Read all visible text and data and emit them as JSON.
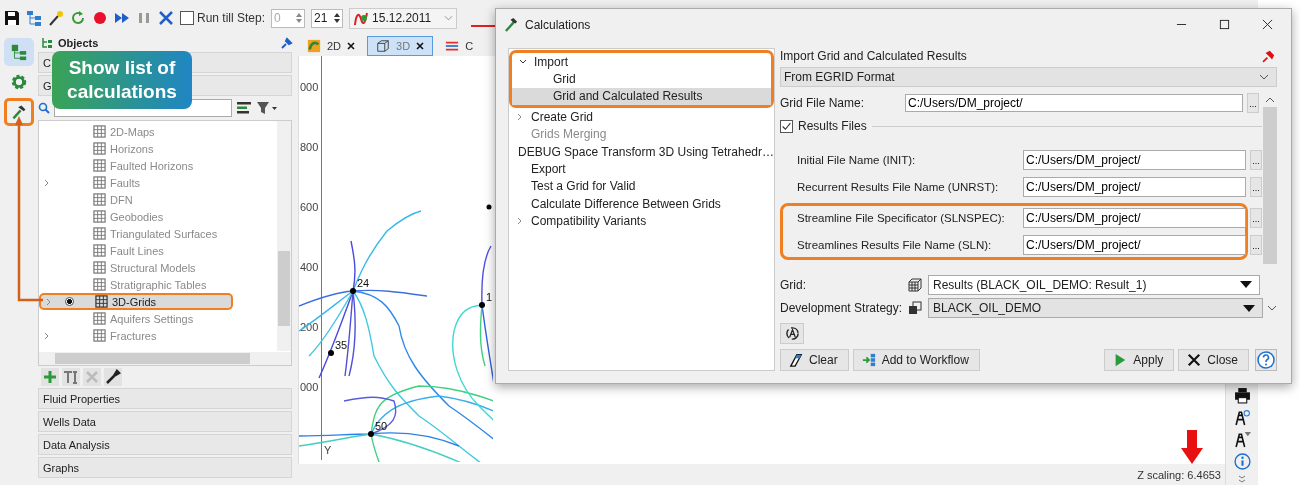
{
  "toolbar": {
    "run_till_step": {
      "label": "Run till Step:",
      "checked": false,
      "value": "0"
    },
    "step_value": "21",
    "date": "15.12.2011"
  },
  "rail": [
    {
      "kind": "tree",
      "selected": true,
      "highlighted": false
    },
    {
      "kind": "gear",
      "selected": false,
      "highlighted": false
    },
    {
      "kind": "hammer",
      "selected": false,
      "highlighted": true
    }
  ],
  "objects_panel": {
    "title": "Objects",
    "top_sections": [
      "C",
      "G"
    ],
    "tree": [
      {
        "label": "2D-Maps",
        "disabled": true,
        "selected": false,
        "highlighted": false
      },
      {
        "label": "Horizons",
        "disabled": true,
        "selected": false,
        "highlighted": false
      },
      {
        "label": "Faulted Horizons",
        "disabled": true,
        "selected": false,
        "highlighted": false
      },
      {
        "label": "Faults",
        "disabled": true,
        "selected": false,
        "highlighted": false,
        "expanded": false
      },
      {
        "label": "DFN",
        "disabled": true,
        "selected": false,
        "highlighted": false
      },
      {
        "label": "Geobodies",
        "disabled": true,
        "selected": false,
        "highlighted": false
      },
      {
        "label": "Triangulated Surfaces",
        "disabled": true,
        "selected": false,
        "highlighted": false
      },
      {
        "label": "Fault Lines",
        "disabled": true,
        "selected": false,
        "highlighted": false
      },
      {
        "label": "Structural Models",
        "disabled": true,
        "selected": false,
        "highlighted": false
      },
      {
        "label": "Stratigraphic Tables",
        "disabled": true,
        "selected": false,
        "highlighted": false
      },
      {
        "label": "3D-Grids",
        "disabled": false,
        "selected": true,
        "highlighted": true,
        "expanded": false,
        "active": true
      },
      {
        "label": "Aquifers Settings",
        "disabled": true,
        "selected": false,
        "highlighted": false
      },
      {
        "label": "Fractures",
        "disabled": true,
        "selected": false,
        "highlighted": false,
        "expanded": false
      }
    ],
    "sections": [
      "Fluid Properties",
      "Wells Data",
      "Data Analysis",
      "Graphs"
    ]
  },
  "callout": "Show list of calculations",
  "viewport": {
    "tabs": [
      {
        "label": "2D",
        "selected": false,
        "closable": true
      },
      {
        "label": "3D",
        "selected": true,
        "closable": true
      },
      {
        "label": "C",
        "selected": false,
        "closable": false
      }
    ],
    "axis_labels": [
      "000",
      "800",
      "600",
      "400",
      "200",
      "000"
    ],
    "axis_title": "Y",
    "wells": [
      "24",
      "35",
      "50",
      "1"
    ],
    "status": "Z scaling: 6.4653"
  },
  "dialog": {
    "title": "Calculations",
    "tree": [
      {
        "label": "Import",
        "selected": false,
        "highlighted": true,
        "expanded": true,
        "children": [
          {
            "label": "Grid",
            "selected": false
          },
          {
            "label": "Grid and Calculated Results",
            "selected": true
          }
        ]
      },
      {
        "label": "Create Grid",
        "selected": false,
        "highlighted": false,
        "expanded": false
      },
      {
        "label": "Grids Merging",
        "selected": false,
        "highlighted": false,
        "disabled": true
      },
      {
        "label": "DEBUG Space Transform 3D Using Tetrahedr…",
        "selected": false,
        "highlighted": false
      },
      {
        "label": "Export",
        "selected": false,
        "highlighted": false
      },
      {
        "label": "Test a Grid for Valid",
        "selected": false,
        "highlighted": false
      },
      {
        "label": "Calculate Difference Between Grids",
        "selected": false,
        "highlighted": false
      },
      {
        "label": "Compatibility Variants",
        "selected": false,
        "highlighted": false,
        "expanded": false
      }
    ],
    "heading": "Import Grid and Calculated Results",
    "format": "From EGRID Format",
    "grid_file": {
      "label": "Grid File Name:",
      "value": "C:/Users/DM_project/",
      "browse": "..."
    },
    "results_files": {
      "label": "Results Files",
      "checked": true
    },
    "files": [
      {
        "label": "Initial File Name (INIT):",
        "value": "C:/Users/DM_project/",
        "browse": "...",
        "highlighted": false
      },
      {
        "label": "Recurrent Results File Name (UNRST):",
        "value": "C:/Users/DM_project/",
        "browse": "...",
        "highlighted": false
      },
      {
        "label": "Streamline File Specificator (SLNSPEC):",
        "value": "C:/Users/DM_project/",
        "browse": "...",
        "highlighted": true
      },
      {
        "label": "Streamlines Results File Name (SLN):",
        "value": "C:/Users/DM_project/",
        "browse": "...",
        "highlighted": true
      }
    ],
    "grid": {
      "label": "Grid:",
      "value": "Results (BLACK_OIL_DEMO: Result_1)"
    },
    "strategy": {
      "label": "Development Strategy:",
      "value": "BLACK_OIL_DEMO"
    },
    "buttons": {
      "clear": "Clear",
      "workflow": "Add to Workflow",
      "apply": "Apply",
      "close": "Close"
    }
  }
}
